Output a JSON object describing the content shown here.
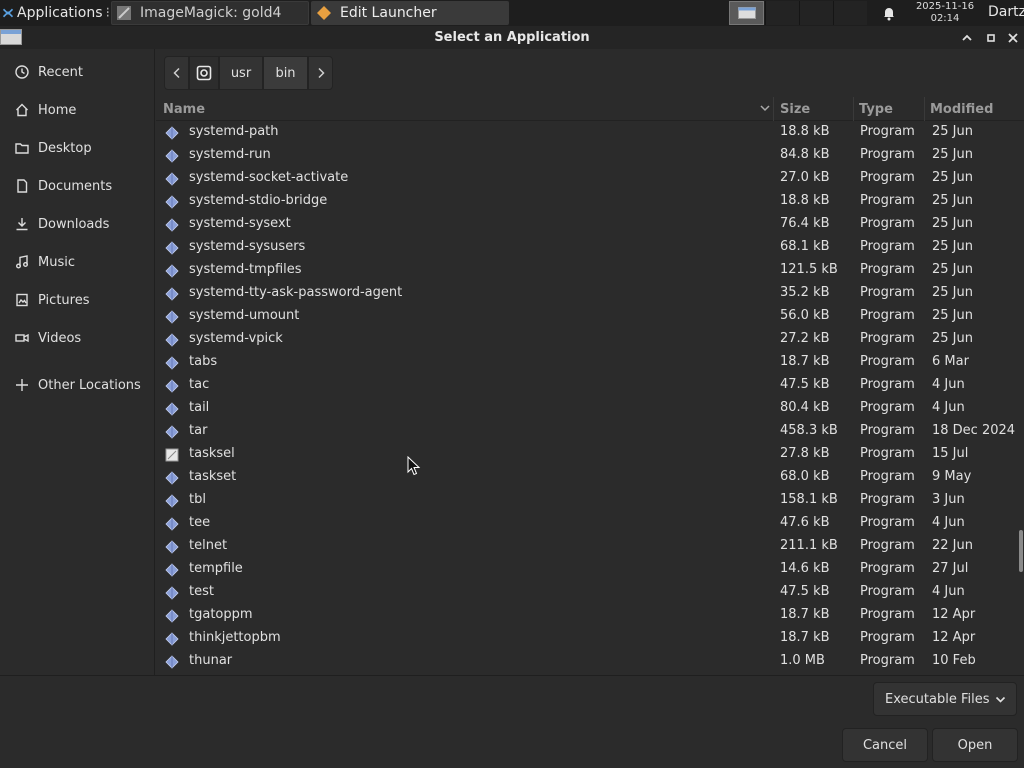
{
  "panel": {
    "applications_label": "Applications",
    "tasks": [
      {
        "label": "ImageMagick: gold4",
        "icon": "imagemagick-icon"
      },
      {
        "label": "Edit Launcher",
        "icon": "launcher-diamond-icon"
      }
    ],
    "clock_date": "2025-11-16",
    "clock_time": "02:14",
    "user": "Dartz"
  },
  "window": {
    "title": "Select an Application"
  },
  "sidebar": {
    "items": [
      {
        "label": "Recent",
        "icon": "clock-icon"
      },
      {
        "label": "Home",
        "icon": "home-icon"
      },
      {
        "label": "Desktop",
        "icon": "folder-icon"
      },
      {
        "label": "Documents",
        "icon": "document-icon"
      },
      {
        "label": "Downloads",
        "icon": "download-icon"
      },
      {
        "label": "Music",
        "icon": "music-icon"
      },
      {
        "label": "Pictures",
        "icon": "pictures-icon"
      },
      {
        "label": "Videos",
        "icon": "video-icon"
      },
      {
        "label": "Other Locations",
        "icon": "plus-icon"
      }
    ]
  },
  "pathbar": {
    "segments": [
      "usr",
      "bin"
    ]
  },
  "list": {
    "headers": {
      "name": "Name",
      "size": "Size",
      "type": "Type",
      "modified": "Modified"
    },
    "rows": [
      {
        "name": "systemd-path",
        "size": "18.8 kB",
        "type": "Program",
        "modified": "25 Jun",
        "icon": "program-diamond-icon"
      },
      {
        "name": "systemd-run",
        "size": "84.8 kB",
        "type": "Program",
        "modified": "25 Jun",
        "icon": "program-diamond-icon"
      },
      {
        "name": "systemd-socket-activate",
        "size": "27.0 kB",
        "type": "Program",
        "modified": "25 Jun",
        "icon": "program-diamond-icon"
      },
      {
        "name": "systemd-stdio-bridge",
        "size": "18.8 kB",
        "type": "Program",
        "modified": "25 Jun",
        "icon": "program-diamond-icon"
      },
      {
        "name": "systemd-sysext",
        "size": "76.4 kB",
        "type": "Program",
        "modified": "25 Jun",
        "icon": "program-diamond-icon"
      },
      {
        "name": "systemd-sysusers",
        "size": "68.1 kB",
        "type": "Program",
        "modified": "25 Jun",
        "icon": "program-diamond-icon"
      },
      {
        "name": "systemd-tmpfiles",
        "size": "121.5 kB",
        "type": "Program",
        "modified": "25 Jun",
        "icon": "program-diamond-icon"
      },
      {
        "name": "systemd-tty-ask-password-agent",
        "size": "35.2 kB",
        "type": "Program",
        "modified": "25 Jun",
        "icon": "program-diamond-icon"
      },
      {
        "name": "systemd-umount",
        "size": "56.0 kB",
        "type": "Program",
        "modified": "25 Jun",
        "icon": "program-diamond-icon"
      },
      {
        "name": "systemd-vpick",
        "size": "27.2 kB",
        "type": "Program",
        "modified": "25 Jun",
        "icon": "program-diamond-icon"
      },
      {
        "name": "tabs",
        "size": "18.7 kB",
        "type": "Program",
        "modified": "6 Mar",
        "icon": "program-diamond-icon"
      },
      {
        "name": "tac",
        "size": "47.5 kB",
        "type": "Program",
        "modified": "4 Jun",
        "icon": "program-diamond-icon"
      },
      {
        "name": "tail",
        "size": "80.4 kB",
        "type": "Program",
        "modified": "4 Jun",
        "icon": "program-diamond-icon"
      },
      {
        "name": "tar",
        "size": "458.3 kB",
        "type": "Program",
        "modified": "18 Dec 2024",
        "icon": "program-diamond-icon"
      },
      {
        "name": "tasksel",
        "size": "27.8 kB",
        "type": "Program",
        "modified": "15 Jul",
        "icon": "tasksel-app-icon"
      },
      {
        "name": "taskset",
        "size": "68.0 kB",
        "type": "Program",
        "modified": "9 May",
        "icon": "program-diamond-icon"
      },
      {
        "name": "tbl",
        "size": "158.1 kB",
        "type": "Program",
        "modified": "3 Jun",
        "icon": "program-diamond-icon"
      },
      {
        "name": "tee",
        "size": "47.6 kB",
        "type": "Program",
        "modified": "4 Jun",
        "icon": "program-diamond-icon"
      },
      {
        "name": "telnet",
        "size": "211.1 kB",
        "type": "Program",
        "modified": "22 Jun",
        "icon": "program-diamond-icon"
      },
      {
        "name": "tempfile",
        "size": "14.6 kB",
        "type": "Program",
        "modified": "27 Jul",
        "icon": "program-diamond-icon"
      },
      {
        "name": "test",
        "size": "47.5 kB",
        "type": "Program",
        "modified": "4 Jun",
        "icon": "program-diamond-icon"
      },
      {
        "name": "tgatoppm",
        "size": "18.7 kB",
        "type": "Program",
        "modified": "12 Apr",
        "icon": "program-diamond-icon"
      },
      {
        "name": "thinkjettopbm",
        "size": "18.7 kB",
        "type": "Program",
        "modified": "12 Apr",
        "icon": "program-diamond-icon"
      },
      {
        "name": "thunar",
        "size": "1.0 MB",
        "type": "Program",
        "modified": "10 Feb",
        "icon": "program-diamond-icon"
      }
    ]
  },
  "footer": {
    "filter_label": "Executable Files",
    "cancel_label": "Cancel",
    "open_label": "Open"
  },
  "colors": {
    "background": "#2b2b2b",
    "panel": "#1e1e1e",
    "program_icon": "#8a9fd8"
  }
}
